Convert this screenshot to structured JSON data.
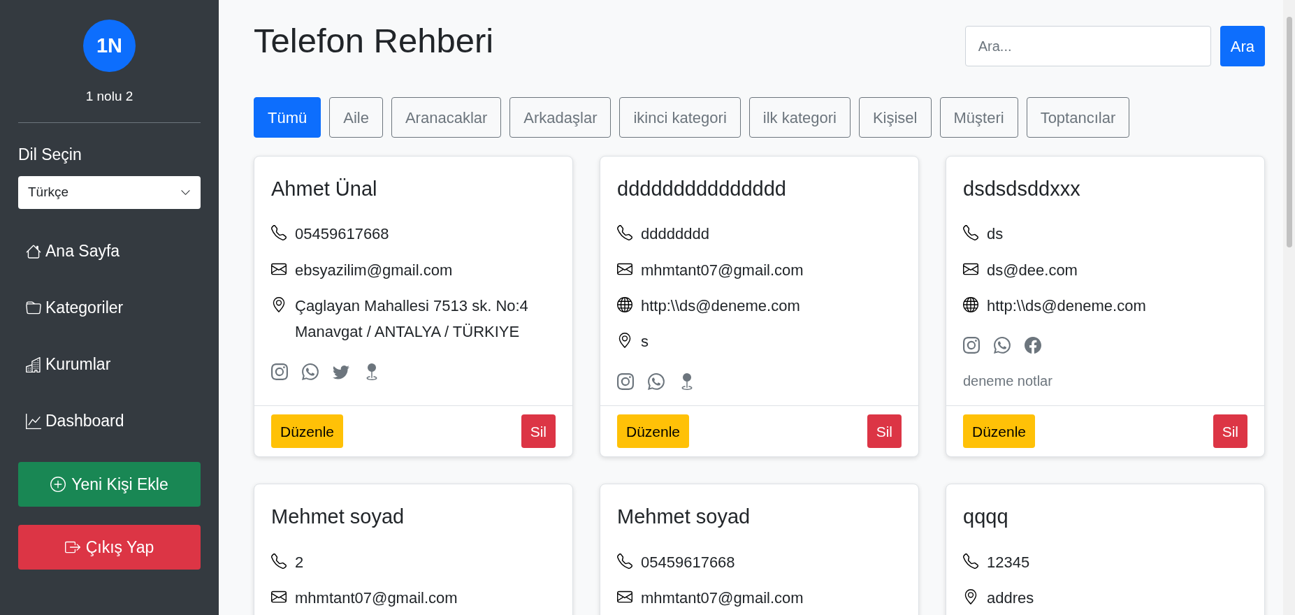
{
  "sidebar": {
    "avatar": "1N",
    "user_name": "1 nolu 2",
    "language_label": "Dil Seçin",
    "language_value": "Türkçe",
    "nav": [
      {
        "label": "Ana Sayfa"
      },
      {
        "label": "Kategoriler"
      },
      {
        "label": "Kurumlar"
      },
      {
        "label": "Dashboard"
      }
    ],
    "add_button": "Yeni Kişi Ekle",
    "logout_button": "Çıkış Yap"
  },
  "header": {
    "title": "Telefon Rehberi",
    "search_placeholder": "Ara...",
    "search_button": "Ara"
  },
  "filters": [
    {
      "label": "Tümü",
      "selected": true
    },
    {
      "label": "Aile",
      "selected": false
    },
    {
      "label": "Aranacaklar",
      "selected": false
    },
    {
      "label": "Arkadaşlar",
      "selected": false
    },
    {
      "label": "ikinci kategori",
      "selected": false
    },
    {
      "label": "ilk kategori",
      "selected": false
    },
    {
      "label": "Kişisel",
      "selected": false
    },
    {
      "label": "Müşteri",
      "selected": false
    },
    {
      "label": "Toptancılar",
      "selected": false
    }
  ],
  "contacts": [
    {
      "name": "Ahmet Ünal",
      "details": [
        {
          "kind": "phone",
          "text": "05459617668"
        },
        {
          "kind": "email",
          "text": "ebsyazilim@gmail.com"
        },
        {
          "kind": "address",
          "text": "Çaglayan Mahallesi 7513 sk. No:4 Manavgat / ANTALYA / TÜRKIYE"
        }
      ],
      "social": [
        {
          "kind": "instagram"
        },
        {
          "kind": "whatsapp"
        },
        {
          "kind": "twitter"
        },
        {
          "kind": "location"
        }
      ],
      "edit_button": "Düzenle",
      "delete_button": "Sil"
    },
    {
      "name": "ddddddddddddddd",
      "details": [
        {
          "kind": "phone",
          "text": "dddddddd"
        },
        {
          "kind": "email",
          "text": "mhmtant07@gmail.com"
        },
        {
          "kind": "website",
          "text": "http:\\\\ds@deneme.com"
        },
        {
          "kind": "address",
          "text": "s"
        }
      ],
      "social": [
        {
          "kind": "instagram"
        },
        {
          "kind": "whatsapp"
        },
        {
          "kind": "location"
        }
      ],
      "edit_button": "Düzenle",
      "delete_button": "Sil"
    },
    {
      "name": "dsdsdsddxxx",
      "details": [
        {
          "kind": "phone",
          "text": "ds"
        },
        {
          "kind": "email",
          "text": "ds@dee.com"
        },
        {
          "kind": "website",
          "text": "http:\\\\ds@deneme.com"
        }
      ],
      "social": [
        {
          "kind": "instagram"
        },
        {
          "kind": "whatsapp"
        },
        {
          "kind": "facebook"
        }
      ],
      "note": "deneme notlar",
      "edit_button": "Düzenle",
      "delete_button": "Sil"
    },
    {
      "name": "Mehmet soyad",
      "details": [
        {
          "kind": "phone",
          "text": "2"
        },
        {
          "kind": "email",
          "text": "mhmtant07@gmail.com"
        }
      ]
    },
    {
      "name": "Mehmet soyad",
      "details": [
        {
          "kind": "phone",
          "text": "05459617668"
        },
        {
          "kind": "email",
          "text": "mhmtant07@gmail.com"
        }
      ]
    },
    {
      "name": "qqqq",
      "details": [
        {
          "kind": "phone",
          "text": "12345"
        },
        {
          "kind": "address",
          "text": "addres"
        }
      ]
    }
  ]
}
